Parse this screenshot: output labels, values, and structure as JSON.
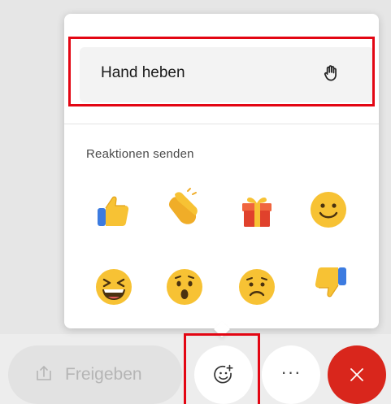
{
  "popup": {
    "raise_hand_label": "Hand heben",
    "raise_hand_icon": "raise-hand-icon",
    "reactions_title": "Reaktionen senden",
    "reactions": [
      {
        "name": "thumbs-up-icon"
      },
      {
        "name": "clapping-hands-icon"
      },
      {
        "name": "gift-icon"
      },
      {
        "name": "smiley-icon"
      },
      {
        "name": "laughing-face-icon"
      },
      {
        "name": "surprised-face-icon"
      },
      {
        "name": "sad-face-icon"
      },
      {
        "name": "thumbs-down-icon"
      }
    ]
  },
  "toolbar": {
    "share_label": "Freigeben",
    "share_icon": "share-upload-icon",
    "reactions_icon": "emoji-add-icon",
    "more_label": "···",
    "leave_icon": "close-icon"
  },
  "colors": {
    "highlight": "#e30613",
    "leave_button": "#d9261c",
    "emoji_yellow": "#f7c234",
    "gift_red": "#e0412c"
  }
}
